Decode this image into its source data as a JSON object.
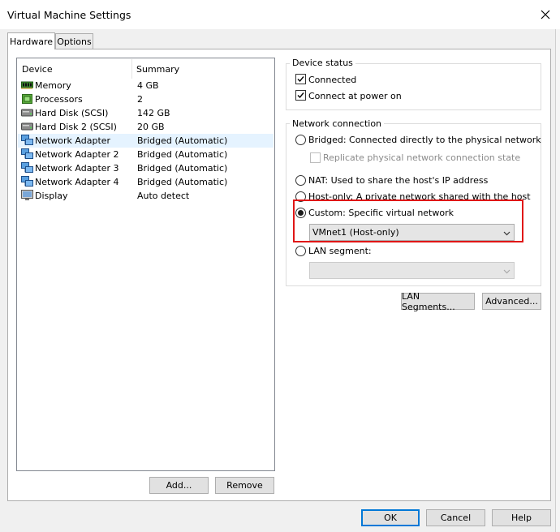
{
  "window": {
    "title": "Virtual Machine Settings"
  },
  "tabs": [
    {
      "label": "Hardware",
      "active": true
    },
    {
      "label": "Options",
      "active": false
    }
  ],
  "device_list": {
    "columns": [
      "Device",
      "Summary"
    ],
    "rows": [
      {
        "device": "Memory",
        "summary": "4 GB",
        "icon": "memory-icon",
        "selected": false
      },
      {
        "device": "Processors",
        "summary": "2",
        "icon": "processor-icon",
        "selected": false
      },
      {
        "device": "Hard Disk (SCSI)",
        "summary": "142 GB",
        "icon": "hard-disk-icon",
        "selected": false
      },
      {
        "device": "Hard Disk 2 (SCSI)",
        "summary": "20 GB",
        "icon": "hard-disk-icon",
        "selected": false
      },
      {
        "device": "Network Adapter",
        "summary": "Bridged (Automatic)",
        "icon": "network-adapter-icon",
        "selected": true
      },
      {
        "device": "Network Adapter 2",
        "summary": "Bridged (Automatic)",
        "icon": "network-adapter-icon",
        "selected": false
      },
      {
        "device": "Network Adapter 3",
        "summary": "Bridged (Automatic)",
        "icon": "network-adapter-icon",
        "selected": false
      },
      {
        "device": "Network Adapter 4",
        "summary": "Bridged (Automatic)",
        "icon": "network-adapter-icon",
        "selected": false
      },
      {
        "device": "Display",
        "summary": "Auto detect",
        "icon": "display-icon",
        "selected": false
      }
    ]
  },
  "list_buttons": {
    "add": "Add...",
    "remove": "Remove"
  },
  "device_status": {
    "title": "Device status",
    "connected": {
      "label": "Connected",
      "checked": true
    },
    "connect_at_power_on": {
      "label": "Connect at power on",
      "checked": true
    }
  },
  "network_connection": {
    "title": "Network connection",
    "bridged": {
      "label": "Bridged: Connected directly to the physical network",
      "selected": false
    },
    "replicate": {
      "label": "Replicate physical network connection state",
      "checked": false,
      "enabled": false
    },
    "nat": {
      "label": "NAT: Used to share the host's IP address",
      "selected": false
    },
    "host_only": {
      "label": "Host-only: A private network shared with the host",
      "selected": false
    },
    "custom": {
      "label": "Custom: Specific virtual network",
      "selected": true
    },
    "custom_network": {
      "value": "VMnet1 (Host-only)"
    },
    "lan_segment": {
      "label": "LAN segment:",
      "selected": false
    },
    "lan_segment_combo": {
      "value": "",
      "enabled": false
    }
  },
  "network_buttons": {
    "lan_segments": "LAN Segments...",
    "advanced": "Advanced..."
  },
  "footer_buttons": {
    "ok": "OK",
    "cancel": "Cancel",
    "help": "Help"
  },
  "colors": {
    "highlight_box": "#e01616",
    "selection_bg": "#e5f3ff",
    "default_button_border": "#0078d7"
  }
}
